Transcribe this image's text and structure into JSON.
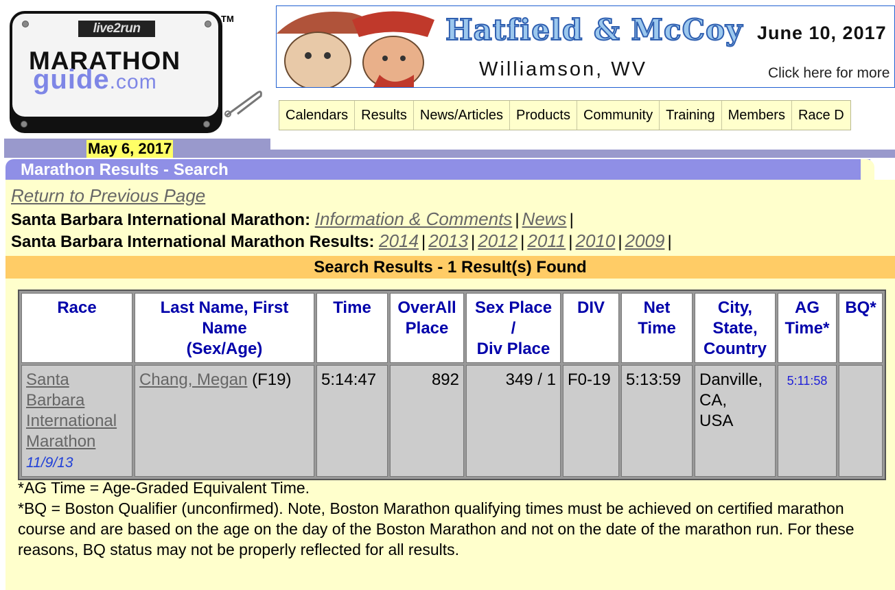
{
  "logo": {
    "brand": "live2run",
    "line1": "MARATHON",
    "line2": "guide",
    "line2_suffix": ".com",
    "tm": "TM"
  },
  "banner": {
    "title": "Hatfield & McCoy",
    "date": "June 10, 2017",
    "place": "Williamson, WV",
    "more": "Click here for more"
  },
  "nav": {
    "items": [
      "Calendars",
      "Results",
      "News/Articles",
      "Products",
      "Community",
      "Training",
      "Members",
      "Race D"
    ]
  },
  "today": "May 6, 2017",
  "section_title": "Marathon Results - Search",
  "return_link": "Return to Previous Page",
  "race_info": {
    "label": "Santa Barbara International Marathon:",
    "info_link": "Information & Comments",
    "news_link": "News",
    "sep": "|"
  },
  "race_results": {
    "label": "Santa Barbara International Marathon Results:",
    "years": [
      "2014",
      "2013",
      "2012",
      "2011",
      "2010",
      "2009"
    ]
  },
  "results_bar": "Search Results - 1 Result(s) Found",
  "table": {
    "headers": {
      "race": "Race",
      "name_l1": "Last Name, First",
      "name_l2": "Name",
      "name_l3": "(Sex/Age)",
      "time": "Time",
      "overall_l1": "OverAll",
      "overall_l2": "Place",
      "sex_l1": "Sex Place",
      "sex_l2": "/",
      "sex_l3": "Div Place",
      "div": "DIV",
      "net_l1": "Net",
      "net_l2": "Time",
      "city_l1": "City,",
      "city_l2": "State,",
      "city_l3": "Country",
      "ag_l1": "AG",
      "ag_l2": "Time*",
      "bq": "BQ*"
    },
    "row": {
      "race_l1": "Santa",
      "race_l2": "Barbara",
      "race_l3": "International",
      "race_l4": "Marathon",
      "race_date": "11/9/13",
      "name": "Chang, Megan",
      "sexage": "(F19)",
      "time": "5:14:47",
      "overall": "892",
      "sexdiv": "349 / 1",
      "div": "F0-19",
      "net": "5:13:59",
      "city_l1": "Danville,",
      "city_l2": "CA,",
      "city_l3": "USA",
      "ag": "5:11:58",
      "bq": ""
    }
  },
  "notes": {
    "ag": "*AG Time = Age-Graded Equivalent Time.",
    "bq": "*BQ = Boston Qualifier (unconfirmed). Note, Boston Marathon qualifying times must be achieved on certified marathon course and are based on the age on the day of the Boston Marathon and not on the date of the marathon run. For these reasons, BQ status may not be properly reflected for all results."
  }
}
